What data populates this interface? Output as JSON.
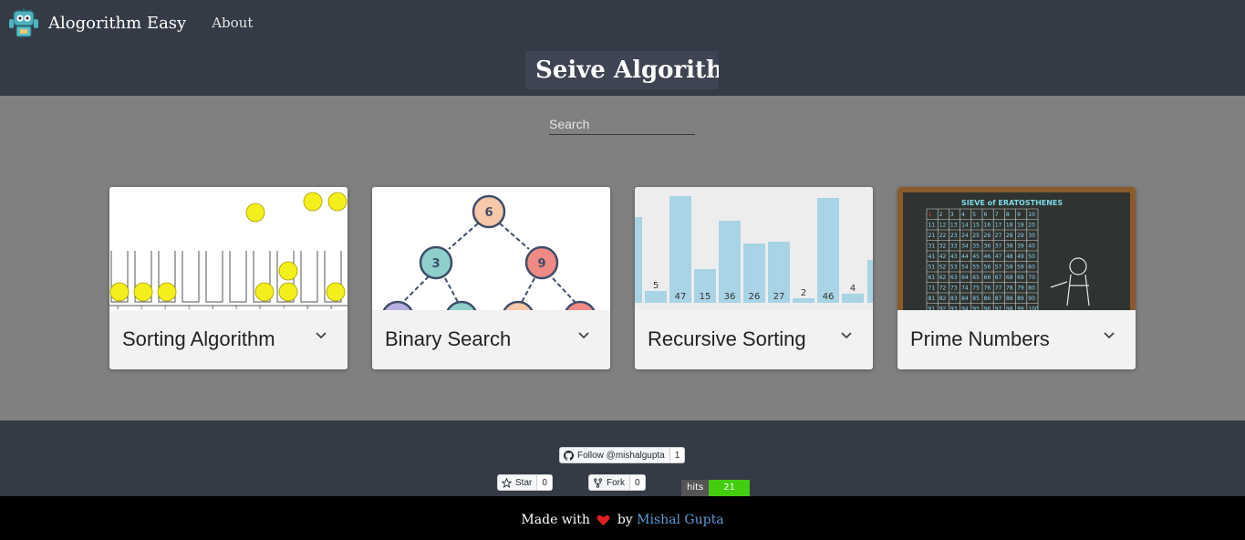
{
  "nav": {
    "brand": "Alogorithm Easy",
    "about": "About"
  },
  "hero": {
    "title": "Seive Algorith|"
  },
  "search": {
    "placeholder": "Search"
  },
  "cards": [
    {
      "title": "Sorting Algorithm"
    },
    {
      "title": "Binary Search"
    },
    {
      "title": "Recursive Sorting",
      "bars": [
        "5",
        "47",
        "15",
        "36",
        "26",
        "27",
        "2",
        "46",
        "4"
      ]
    },
    {
      "title": "Prime Numbers",
      "board_title": "SIEVE of ERATOSTHENES"
    }
  ],
  "binary_tree": {
    "root": "6",
    "left": "3",
    "right": "9"
  },
  "footer": {
    "follow_label": "Follow @mishalgupta",
    "follow_count": "1",
    "star_label": "Star",
    "star_count": "0",
    "fork_label": "Fork",
    "fork_count": "0",
    "hits_label": "hits",
    "hits_value": "21",
    "made_with": "Made with",
    "by": "by",
    "author": "Mishal Gupta"
  },
  "colors": {
    "navbar": "#343a46",
    "body": "#808080",
    "footer_bottom": "#000000",
    "author_link": "#5b9bd5",
    "heart": "#e02020"
  }
}
